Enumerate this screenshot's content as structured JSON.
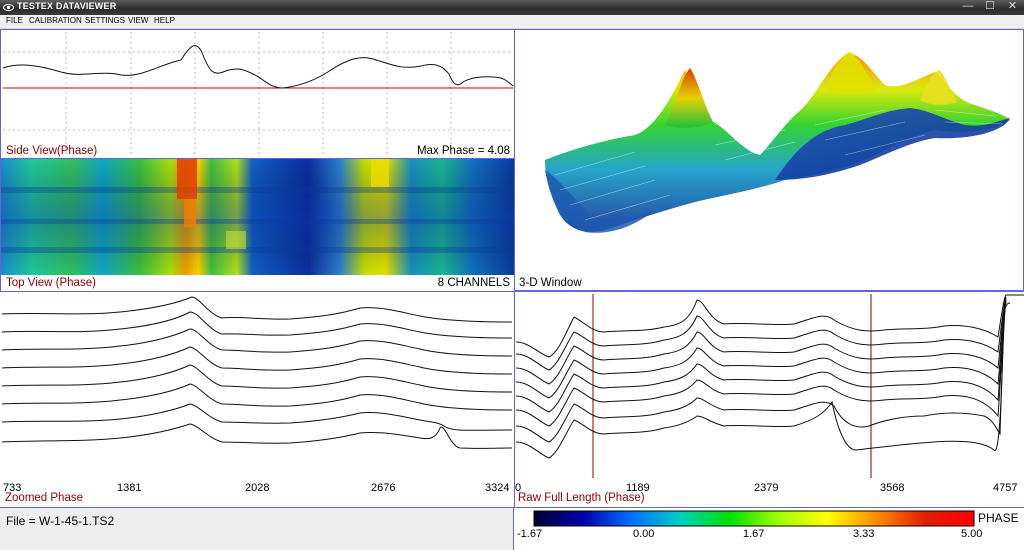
{
  "window": {
    "title": "TESTEX DATAVIEWER",
    "min_glyph": "—",
    "max_glyph": "☐",
    "close_glyph": "✕"
  },
  "menu": [
    "FILE",
    "CALIBRATION",
    "SETTINGS",
    "VIEW",
    "HELP"
  ],
  "side_view": {
    "label": "Side View(Phase)",
    "max_phase_text": "Max Phase = 4.08"
  },
  "top_view": {
    "label": "Top View (Phase)",
    "channels_text": "8 CHANNELS"
  },
  "three_d": {
    "label": "3-D Window"
  },
  "zoomed": {
    "label": "Zoomed Phase",
    "ticks": [
      "733",
      "1381",
      "2028",
      "2676",
      "3324"
    ]
  },
  "raw": {
    "label": "Raw Full Length (Phase)",
    "ticks": [
      "0",
      "1189",
      "2379",
      "3568",
      "4757"
    ]
  },
  "status": {
    "file_text": "File = W-1-45-1.TS2"
  },
  "legend": {
    "title": "PHASE",
    "ticks": [
      "-1.67",
      "0.00",
      "1.67",
      "3.33",
      "5.00"
    ],
    "colors": [
      "#000033",
      "#0000aa",
      "#0070ff",
      "#00d0c0",
      "#00e000",
      "#a0ff00",
      "#ffff00",
      "#ff8c00",
      "#e02000",
      "#ff0000"
    ]
  },
  "colors": {
    "pane_border": "#6464d8",
    "label_red": "#8b0000",
    "baseline": "#c00000"
  }
}
